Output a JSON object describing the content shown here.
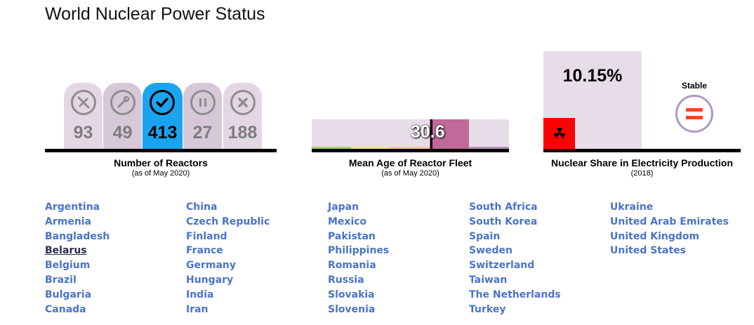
{
  "page_title": "World Nuclear Power Status",
  "reactors": {
    "title": "Number of Reactors",
    "subtitle": "(as of May 2020)",
    "towers": [
      {
        "value": "93",
        "icon": "wrench-screwdriver-icon",
        "state": "under-construction"
      },
      {
        "value": "49",
        "icon": "wrench-icon",
        "state": "planned"
      },
      {
        "value": "413",
        "icon": "check-icon",
        "state": "operating",
        "active": true
      },
      {
        "value": "27",
        "icon": "pause-icon",
        "state": "long-term-shutdown"
      },
      {
        "value": "188",
        "icon": "x-icon",
        "state": "closed"
      }
    ],
    "colors": {
      "tower": "#dcd0dc",
      "tower_alt": "#cdbfcf",
      "active": "#1aa3ef"
    }
  },
  "fleet_age": {
    "title": "Mean Age of Reactor Fleet",
    "subtitle": "(as of May 2020)",
    "value": "30.6"
  },
  "share": {
    "title": "Nuclear Share in Electricity Production",
    "subtitle": "(2018)",
    "value": "10.15%",
    "trend_label": "Stable",
    "trend_icon": "equals-icon",
    "colors": {
      "bar": "#e6dde8",
      "marker": "#ff0000",
      "equals": "#e94a1f"
    }
  },
  "countries": [
    [
      "Argentina",
      "Armenia",
      "Bangladesh",
      "Belarus",
      "Belgium",
      "Brazil",
      "Bulgaria",
      "Canada"
    ],
    [
      "China",
      "Czech Republic",
      "Finland",
      "France",
      "Germany",
      "Hungary",
      "India",
      "Iran"
    ],
    [
      "Japan",
      "Mexico",
      "Pakistan",
      "Philippines",
      "Romania",
      "Russia",
      "Slovakia",
      "Slovenia"
    ],
    [
      "South Africa",
      "South Korea",
      "Spain",
      "Sweden",
      "Switzerland",
      "Taiwan",
      "The Netherlands",
      "Turkey"
    ],
    [
      "Ukraine",
      "United Arab Emirates",
      "United Kingdom",
      "United States"
    ]
  ],
  "hovered_country": "Belarus",
  "link_color": "#4a74c8"
}
